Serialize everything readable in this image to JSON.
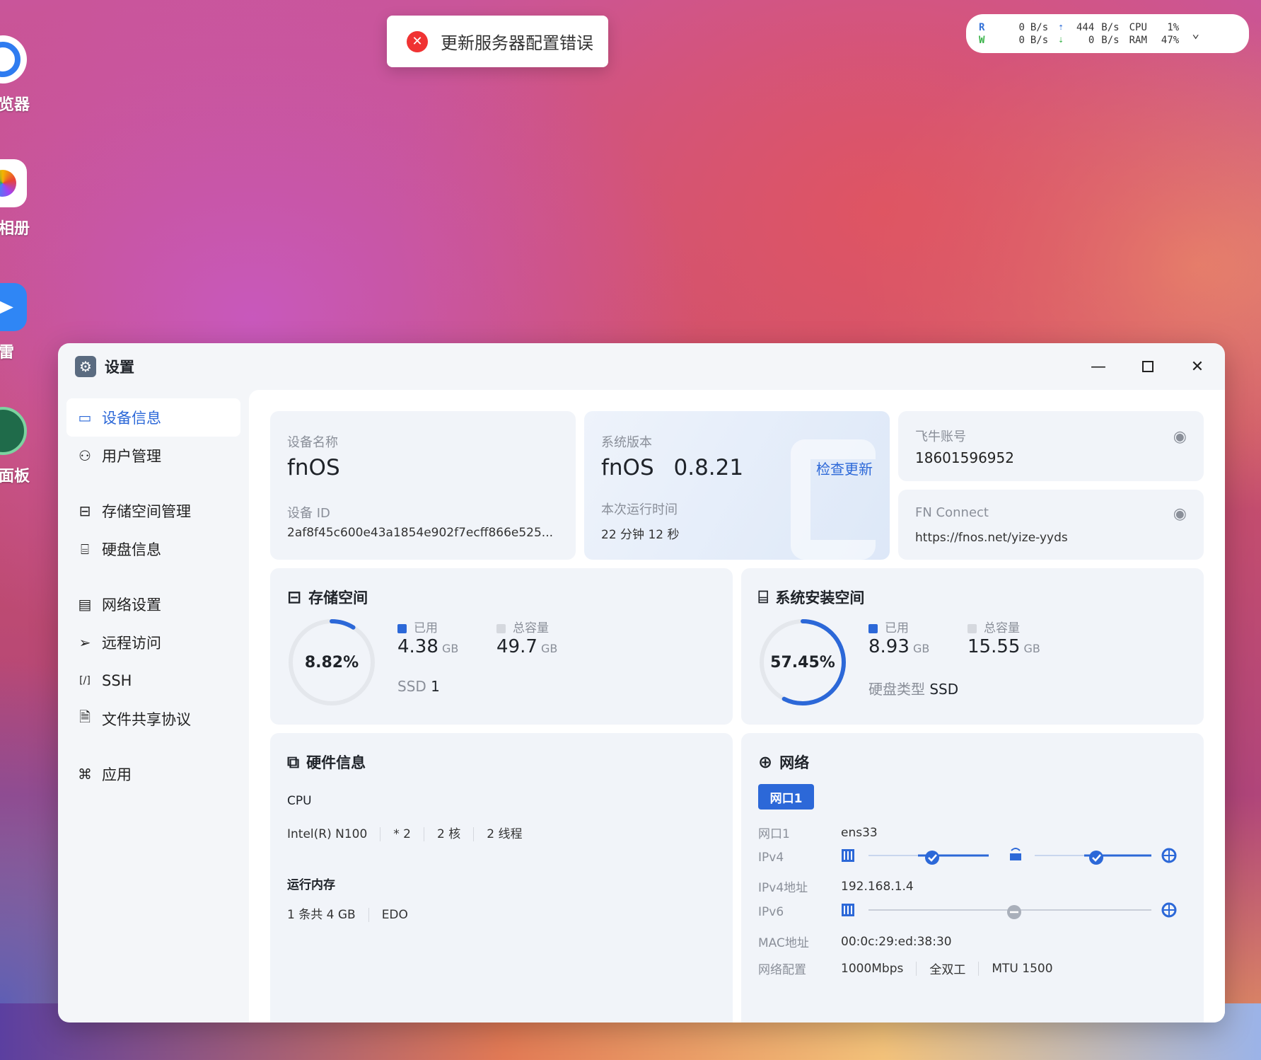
{
  "desktop": {
    "icons": [
      {
        "label": "览器"
      },
      {
        "label": "相册"
      },
      {
        "label": "雷"
      },
      {
        "label": "面板"
      }
    ]
  },
  "toast": {
    "message": "更新服务器配置错误"
  },
  "monitor": {
    "r_label": "R",
    "w_label": "W",
    "read_speed": "0",
    "write_speed": "0",
    "unit": "B/s",
    "up_speed": "444",
    "down_speed": "0",
    "cpu_label": "CPU",
    "ram_label": "RAM",
    "cpu_value": "1%",
    "ram_value": "47%"
  },
  "window": {
    "title": "设置"
  },
  "sidebar": {
    "items": [
      {
        "label": "设备信息",
        "icon": "monitor-icon"
      },
      {
        "label": "用户管理",
        "icon": "user-icon"
      },
      {
        "label": "存储空间管理",
        "icon": "storage-icon"
      },
      {
        "label": "硬盘信息",
        "icon": "disk-icon"
      },
      {
        "label": "网络设置",
        "icon": "network-icon"
      },
      {
        "label": "远程访问",
        "icon": "send-icon"
      },
      {
        "label": "SSH",
        "icon": "terminal-icon"
      },
      {
        "label": "文件共享协议",
        "icon": "file-icon"
      },
      {
        "label": "应用",
        "icon": "apps-icon"
      }
    ]
  },
  "device": {
    "name_label": "设备名称",
    "name": "fnOS",
    "id_label": "设备 ID",
    "id": "2af8f45c600e43a1854e902f7ecff866e525..."
  },
  "system": {
    "version_label": "系统版本",
    "os": "fnOS",
    "version": "0.8.21",
    "check_update": "检查更新",
    "uptime_label": "本次运行时间",
    "uptime": "22 分钟 12 秒"
  },
  "account": {
    "label": "飞牛账号",
    "value": "18601596952"
  },
  "fnconnect": {
    "label": "FN Connect",
    "value": "https://fnos.net/yize-yyds"
  },
  "storage": {
    "title": "存储空间",
    "percent_text": "8.82%",
    "percent": 8.82,
    "used_label": "已用",
    "used": "4.38",
    "used_unit": "GB",
    "total_label": "总容量",
    "total": "49.7",
    "total_unit": "GB",
    "type_label": "SSD",
    "type_count": "1"
  },
  "sysinstall": {
    "title": "系统安装空间",
    "percent_text": "57.45%",
    "percent": 57.45,
    "used_label": "已用",
    "used": "8.93",
    "used_unit": "GB",
    "total_label": "总容量",
    "total": "15.55",
    "total_unit": "GB",
    "disk_type_label": "硬盘类型",
    "disk_type": "SSD"
  },
  "hardware": {
    "title": "硬件信息",
    "cpu_label": "CPU",
    "cpu_model": "Intel(R) N100",
    "cpu_count": "* 2",
    "cores": "2 核",
    "threads": "2 线程",
    "ram_label": "运行内存",
    "ram_sticks": "1 条共 4 GB",
    "ram_type": "EDO"
  },
  "network": {
    "title": "网络",
    "tab": "网口1",
    "port_label": "网口1",
    "port": "ens33",
    "ipv4_label": "IPv4",
    "ipv4_addr_label": "IPv4地址",
    "ipv4_addr": "192.168.1.4",
    "ipv6_label": "IPv6",
    "mac_label": "MAC地址",
    "mac": "00:0c:29:ed:38:30",
    "config_label": "网络配置",
    "speed": "1000Mbps",
    "duplex": "全双工",
    "mtu": "MTU 1500"
  },
  "colors": {
    "accent": "#2c68d8",
    "error": "#f03333",
    "ring_track": "#e4e7ec"
  }
}
